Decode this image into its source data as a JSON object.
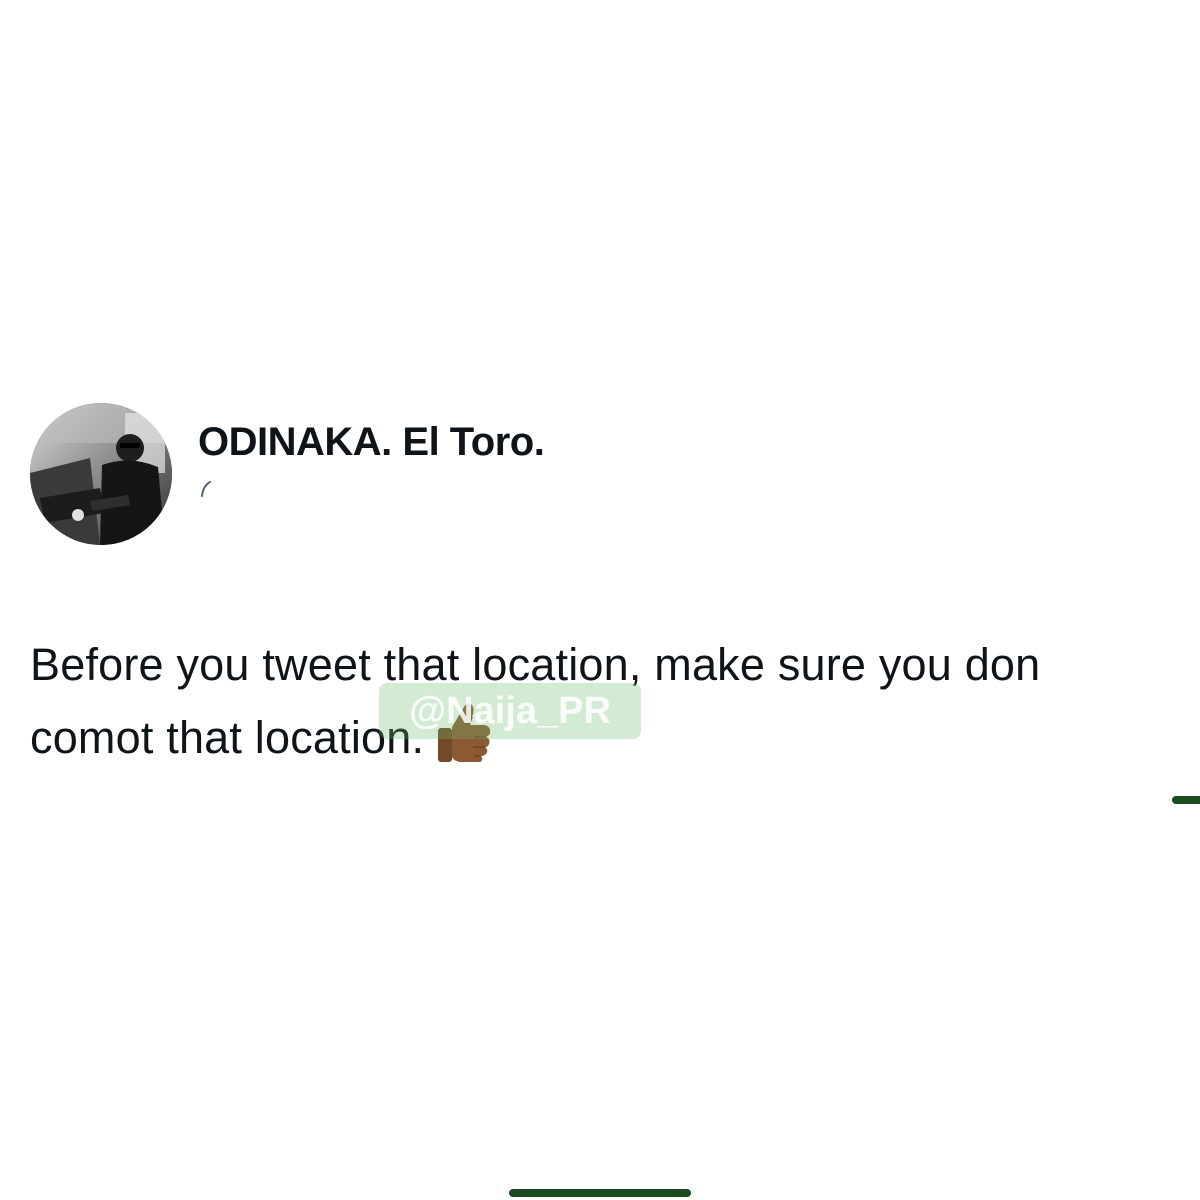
{
  "tweet": {
    "display_name": "ODINAKA. El Toro.",
    "text": "Before you tweet that location, make sure you don comot that location.",
    "emoji_icon": "thumbs-up-icon"
  },
  "watermark": {
    "text": "@Naija_PR"
  },
  "colors": {
    "text": "#0f1419",
    "watermark_bg": "#6ebe6e",
    "indicator": "#1a4a1f"
  }
}
